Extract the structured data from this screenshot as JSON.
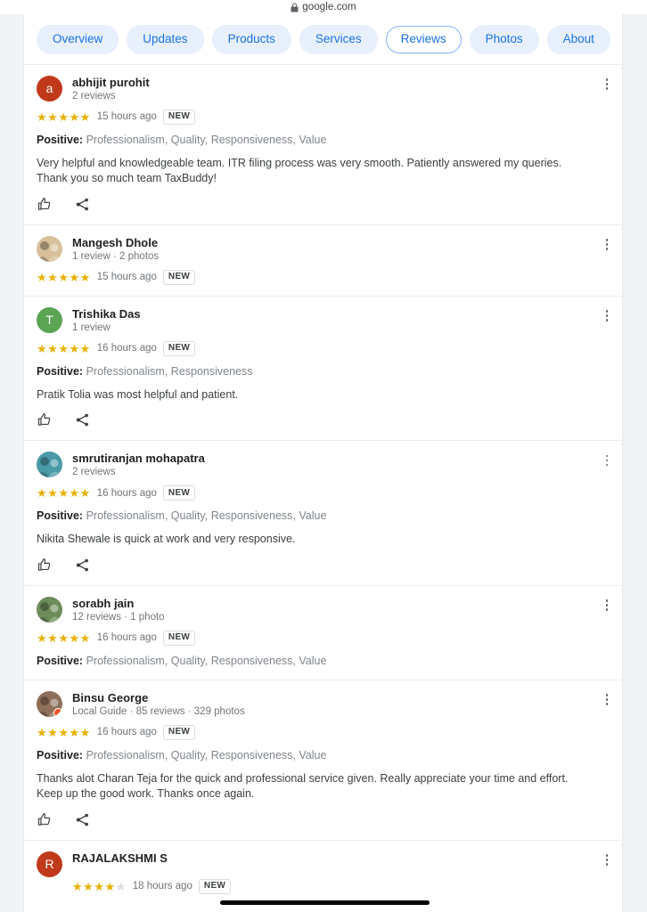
{
  "browser": {
    "url": "google.com",
    "lock_icon": "lock-icon"
  },
  "nav": {
    "tabs": [
      {
        "label": "Overview",
        "active": false
      },
      {
        "label": "Updates",
        "active": false
      },
      {
        "label": "Products",
        "active": false
      },
      {
        "label": "Services",
        "active": false
      },
      {
        "label": "Reviews",
        "active": true
      },
      {
        "label": "Photos",
        "active": false
      },
      {
        "label": "About",
        "active": false
      }
    ]
  },
  "colors": {
    "pill_bg": "#e8f0fe",
    "pill_text": "#1a73e8",
    "active_border": "#8ab4f8",
    "star_gold": "#e7b100",
    "star_empty": "#dadce0",
    "page_bg": "#f1f3f4",
    "meta_text": "#70757a"
  },
  "labels": {
    "positive_prefix": "Positive:",
    "new_badge": "NEW",
    "like_icon": "thumbs-up-icon",
    "share_icon": "share-icon",
    "more_icon": "more-vertical-icon"
  },
  "reviews": [
    {
      "name": "abhijit purohit",
      "meta": "2 reviews",
      "avatar_type": "letter",
      "avatar_letter": "a",
      "avatar_color": "#c0391b",
      "local_guide": false,
      "stars": 5,
      "time": "15 hours ago",
      "is_new": true,
      "tags": "Professionalism, Quality, Responsiveness, Value",
      "text": "Very helpful and knowledgeable team. ITR filing process was very smooth. Patiently answered my queries. Thank you so much team TaxBuddy!",
      "has_actions": true
    },
    {
      "name": "Mangesh Dhole",
      "meta": "1 review · 2 photos",
      "avatar_type": "photo",
      "avatar_letter": "",
      "avatar_color": "#d8c09a",
      "local_guide": false,
      "stars": 5,
      "time": "15 hours ago",
      "is_new": true,
      "tags": "",
      "text": "",
      "has_actions": false
    },
    {
      "name": "Trishika Das",
      "meta": "1 review",
      "avatar_type": "letter",
      "avatar_letter": "T",
      "avatar_color": "#5aa454",
      "local_guide": false,
      "stars": 5,
      "time": "16 hours ago",
      "is_new": true,
      "tags": "Professionalism, Responsiveness",
      "text": "Pratik Tolia was most helpful and patient.",
      "has_actions": true
    },
    {
      "name": "smrutiranjan mohapatra",
      "meta": "2 reviews",
      "avatar_type": "photo",
      "avatar_letter": "",
      "avatar_color": "#4a9aa8",
      "local_guide": false,
      "stars": 5,
      "time": "16 hours ago",
      "is_new": true,
      "tags": "Professionalism, Quality, Responsiveness, Value",
      "text": "Nikita Shewale is quick at work and very responsive.",
      "has_actions": true
    },
    {
      "name": "sorabh jain",
      "meta": "12 reviews · 1 photo",
      "avatar_type": "photo",
      "avatar_letter": "",
      "avatar_color": "#6d8c5a",
      "local_guide": false,
      "stars": 5,
      "time": "16 hours ago",
      "is_new": true,
      "tags": "Professionalism, Quality, Responsiveness, Value",
      "text": "",
      "has_actions": false
    },
    {
      "name": "Binsu George",
      "meta": "Local Guide · 85 reviews · 329 photos",
      "avatar_type": "photo",
      "avatar_letter": "",
      "avatar_color": "#8e6f5a",
      "local_guide": true,
      "stars": 5,
      "time": "16 hours ago",
      "is_new": true,
      "tags": "Professionalism, Quality, Responsiveness, Value",
      "text": "Thanks alot Charan Teja for the quick and professional service given. Really appreciate your time and effort. Keep up the good work. Thanks once again.",
      "has_actions": true
    },
    {
      "name": "RAJALAKSHMI S",
      "meta": "",
      "avatar_type": "letter",
      "avatar_letter": "R",
      "avatar_color": "#c0391b",
      "local_guide": false,
      "stars": 4,
      "time": "18 hours ago",
      "is_new": true,
      "tags": "",
      "text": "",
      "has_actions": false
    }
  ]
}
